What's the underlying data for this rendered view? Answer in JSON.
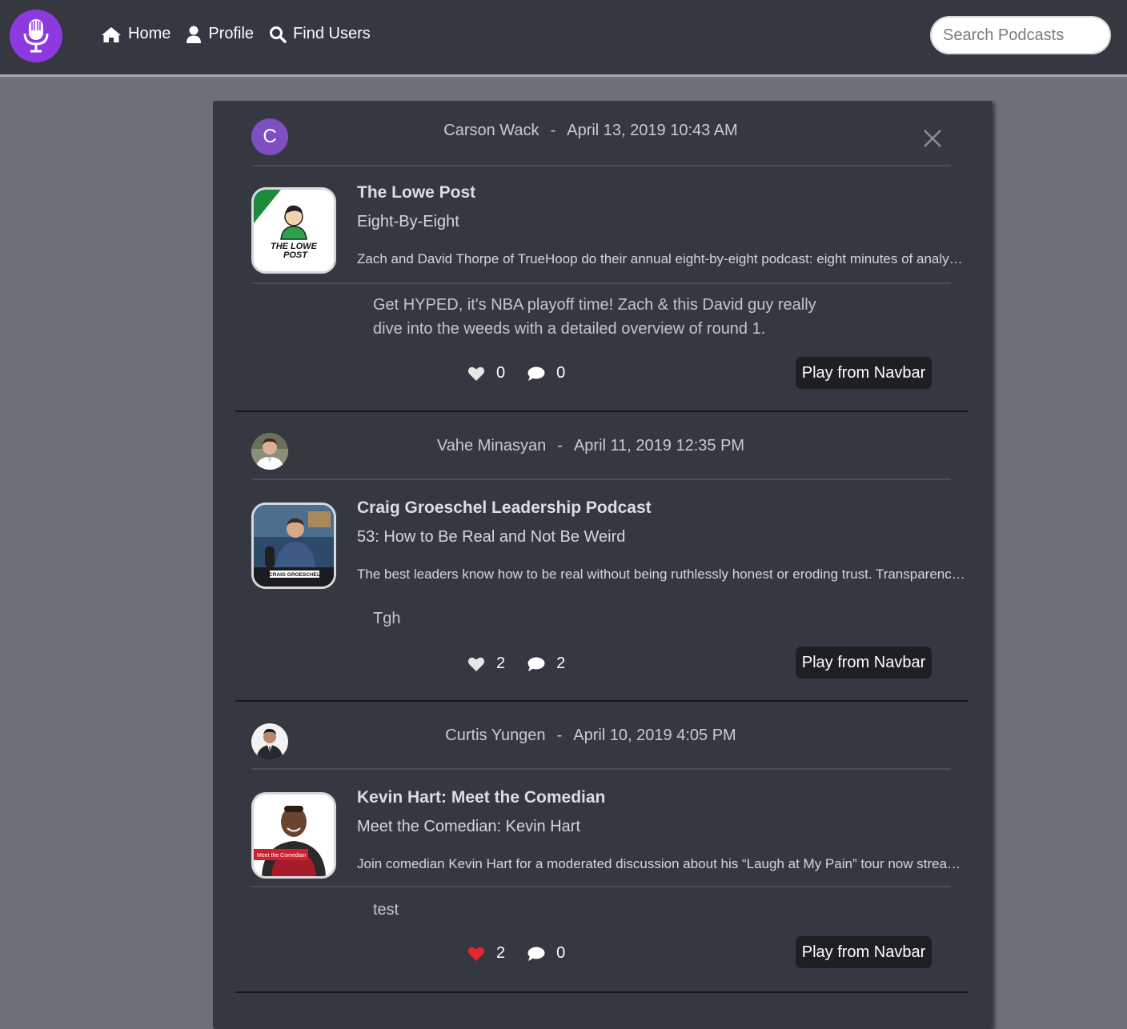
{
  "nav": {
    "home": "Home",
    "profile": "Profile",
    "find_users": "Find Users",
    "search_placeholder": "Search Podcasts"
  },
  "colors": {
    "logo_purple": "#8e39e0",
    "liked_heart": "#e3262b",
    "unliked_heart": "#e6e6e6"
  },
  "posts": [
    {
      "avatar_letter": "C",
      "user": "Carson Wack",
      "separator": "-",
      "date": "April 13, 2019 10:43 AM",
      "podcast": "The Lowe Post",
      "episode": "Eight-By-Eight",
      "description": "Zach and David Thorpe of TrueHoop do their annual eight-by-eight podcast: eight minutes of analysis for each of the eight first-round series.",
      "comment": "Get HYPED, it's NBA playoff time! Zach & this David guy really dive into the weeds with a detailed overview of round 1.",
      "likes": "0",
      "comments": "0",
      "liked": false,
      "play_label": "Play from Navbar"
    },
    {
      "user": "Vahe Minasyan",
      "separator": "-",
      "date": "April 11, 2019 12:35 PM",
      "podcast": "Craig Groeschel Leadership Podcast",
      "episode": "53: How to Be Real and Not Be Weird",
      "description": "The best leaders know how to be real without being ruthlessly honest or eroding trust. Transparency builds trust.",
      "comment": "Tgh",
      "likes": "2",
      "comments": "2",
      "liked": false,
      "play_label": "Play from Navbar"
    },
    {
      "user": "Curtis Yungen",
      "separator": "-",
      "date": "April 10, 2019 4:05 PM",
      "podcast": "Kevin Hart: Meet the Comedian",
      "episode": "Meet the Comedian: Kevin Hart",
      "description": "Join comedian Kevin Hart for a moderated discussion about his “Laugh at My Pain” tour now streaming.",
      "comment": "test",
      "likes": "2",
      "comments": "0",
      "liked": true,
      "play_label": "Play from Navbar"
    }
  ],
  "art_labels": {
    "lowe_top": "THE LOWE",
    "lowe_bottom": "POST",
    "craig": "CRAIG GROESCHEL",
    "kevin": "Meet the Comedian"
  }
}
